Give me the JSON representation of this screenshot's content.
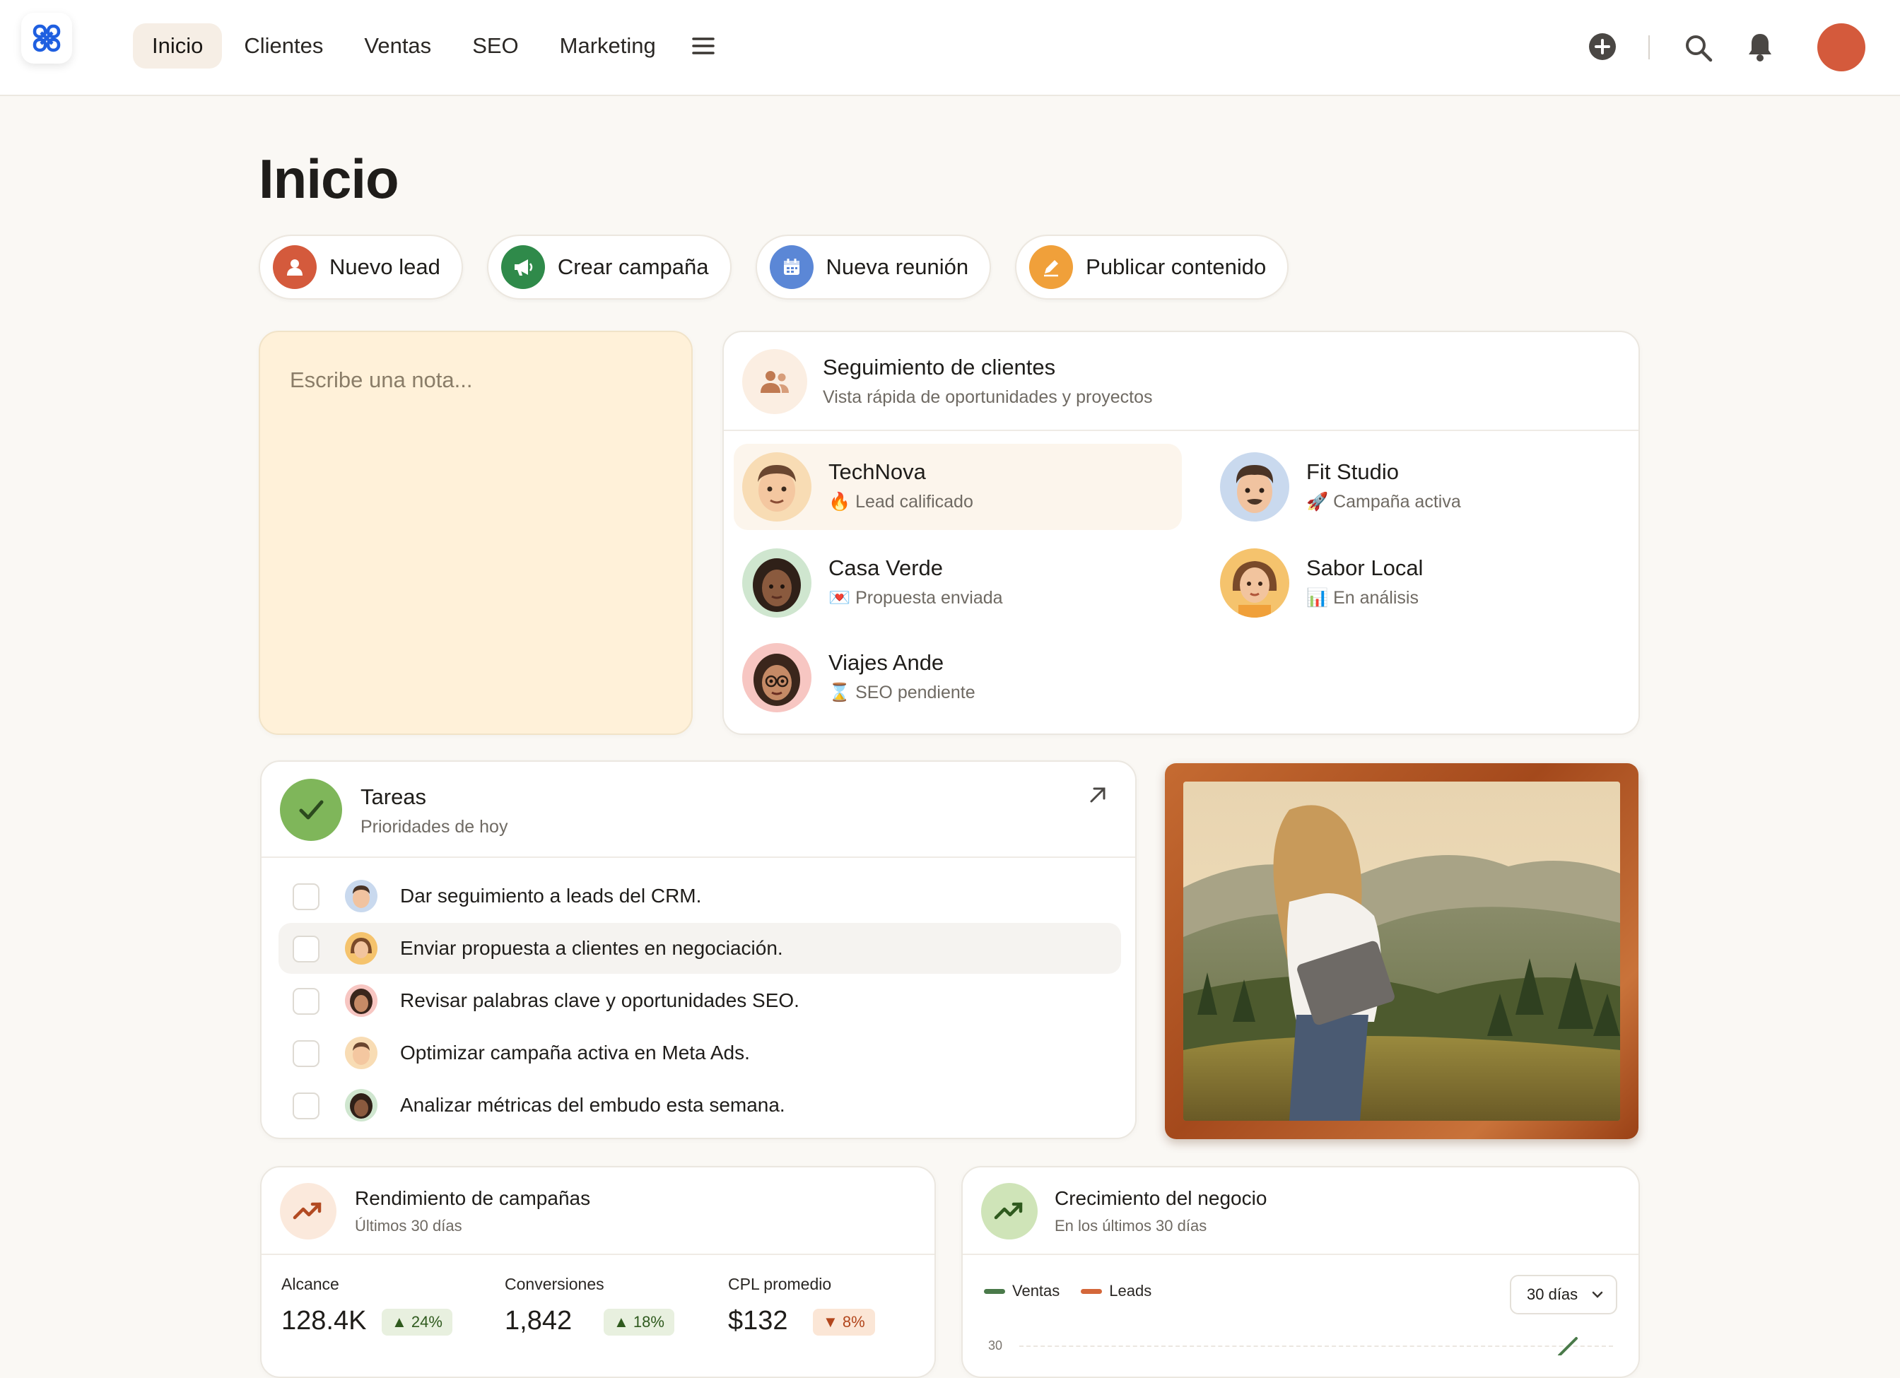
{
  "nav": {
    "items": [
      "Inicio",
      "Clientes",
      "Ventas",
      "SEO",
      "Marketing"
    ],
    "active": "Inicio"
  },
  "page": {
    "title": "Inicio"
  },
  "quick_actions": [
    {
      "label": "Nuevo lead",
      "icon": "user-icon",
      "color": "#d45a3c"
    },
    {
      "label": "Crear campaña",
      "icon": "megaphone-icon",
      "color": "#2f8a4a"
    },
    {
      "label": "Nueva reunión",
      "icon": "calendar-icon",
      "color": "#5b87d6"
    },
    {
      "label": "Publicar contenido",
      "icon": "pencil-icon",
      "color": "#f0a03a"
    }
  ],
  "note": {
    "placeholder": "Escribe una nota..."
  },
  "clients_card": {
    "title": "Seguimiento de clientes",
    "subtitle": "Vista rápida de oportunidades y proyectos",
    "clients": [
      {
        "name": "TechNova",
        "status": "🔥 Lead calificado",
        "avatar_bg": "#f8dcb4"
      },
      {
        "name": "Fit Studio",
        "status": "🚀 Campaña activa",
        "avatar_bg": "#c9d9ee"
      },
      {
        "name": "Casa Verde",
        "status": "💌 Propuesta enviada",
        "avatar_bg": "#cfe6cf"
      },
      {
        "name": "Sabor Local",
        "status": "📊 En análisis",
        "avatar_bg": "#f5c36d"
      },
      {
        "name": "Viajes Ande",
        "status": "⌛ SEO pendiente",
        "avatar_bg": "#f7c6c2"
      }
    ]
  },
  "tasks_card": {
    "title": "Tareas",
    "subtitle": "Prioridades de hoy",
    "tasks": [
      {
        "text": "Dar seguimiento a leads del CRM.",
        "checked": false
      },
      {
        "text": "Enviar propuesta a clientes en negociación.",
        "checked": false
      },
      {
        "text": "Revisar palabras clave y oportunidades SEO.",
        "checked": false
      },
      {
        "text": "Optimizar campaña activa en Meta Ads.",
        "checked": false
      },
      {
        "text": "Analizar métricas del embudo esta semana.",
        "checked": false
      }
    ]
  },
  "performance_card": {
    "title": "Rendimiento de campañas",
    "subtitle": "Últimos 30 días",
    "metrics": [
      {
        "label": "Alcance",
        "value": "128.4K",
        "change": "▲ 24%",
        "trend": "up"
      },
      {
        "label": "Conversiones",
        "value": "1,842",
        "change": "▲ 18%",
        "trend": "up"
      },
      {
        "label": "CPL promedio",
        "value": "$132",
        "change": "▼ 8%",
        "trend": "down"
      }
    ]
  },
  "growth_card": {
    "title": "Crecimiento del negocio",
    "subtitle": "En los últimos 30 días",
    "legend": [
      {
        "name": "Ventas",
        "color": "#4a7a4a"
      },
      {
        "name": "Leads",
        "color": "#d4673a"
      }
    ],
    "range_select": "30 días",
    "y_tick": "30"
  },
  "colors": {
    "accent": "#d45a3c",
    "note_bg": "#fff1d9",
    "success": "#7fb65a"
  }
}
